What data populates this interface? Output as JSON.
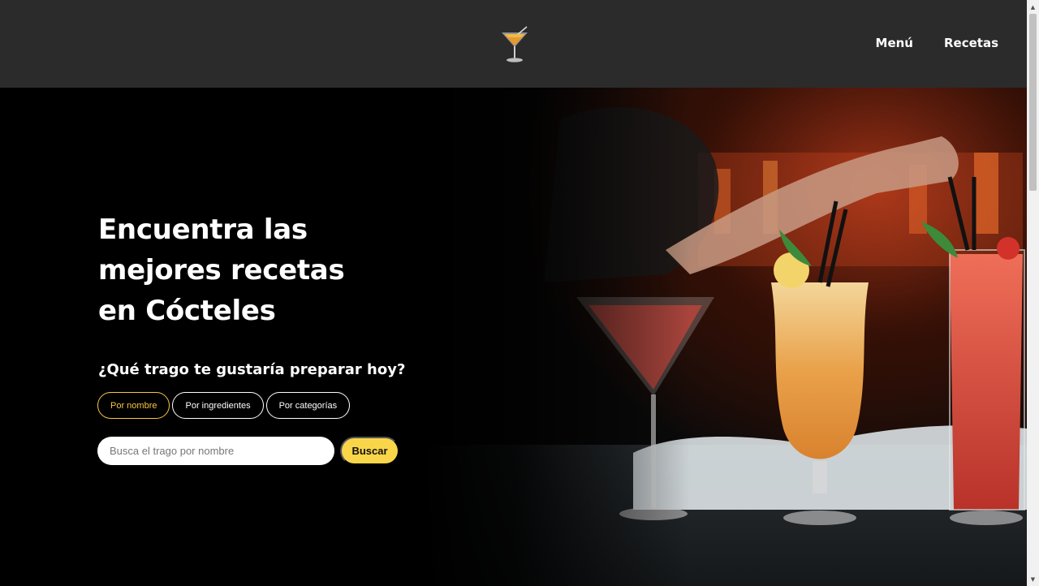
{
  "nav": {
    "menu": "Menú",
    "recipes": "Recetas"
  },
  "logo": {
    "icon": "cocktail-glass-icon"
  },
  "hero": {
    "title_line1": "Encuentra las",
    "title_line2": "mejores recetas",
    "title_line3": "en Cócteles",
    "question": "¿Qué trago te gustaría preparar hoy?",
    "filters": [
      {
        "label": "Por nombre",
        "active": true
      },
      {
        "label": "Por ingredientes",
        "active": false
      },
      {
        "label": "Por categorías",
        "active": false
      }
    ],
    "search": {
      "placeholder": "Busca el trago por nombre",
      "value": "",
      "button": "Buscar"
    }
  },
  "colors": {
    "header_bg": "#2b2b2b",
    "accent": "#f5c842",
    "button_bg": "#f9d54a"
  }
}
